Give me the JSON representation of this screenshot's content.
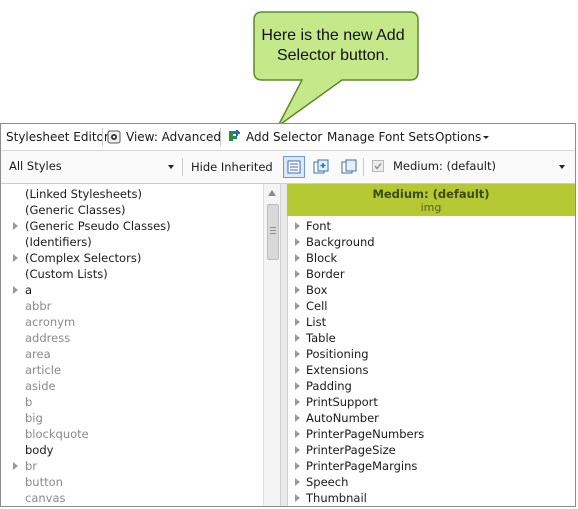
{
  "callout": {
    "text": "Here is the new Add Selector button."
  },
  "toolbar": {
    "stylesheet_editor": "Stylesheet Editor",
    "view": "View: Advanced",
    "add_selector": "Add Selector",
    "manage_font_sets": "Manage Font Sets",
    "options": "Options"
  },
  "filter": {
    "styles_selected": "All Styles",
    "hide_inherited": "Hide Inherited",
    "medium_selected": "Medium: (default)"
  },
  "left_tree": [
    {
      "label": "(Linked Stylesheets)",
      "expandable": false,
      "muted": false
    },
    {
      "label": "(Generic Classes)",
      "expandable": false,
      "muted": false
    },
    {
      "label": "(Generic Pseudo Classes)",
      "expandable": true,
      "muted": false
    },
    {
      "label": "(Identifiers)",
      "expandable": false,
      "muted": false
    },
    {
      "label": "(Complex Selectors)",
      "expandable": true,
      "muted": false
    },
    {
      "label": "(Custom Lists)",
      "expandable": false,
      "muted": false
    },
    {
      "label": "a",
      "expandable": true,
      "muted": false
    },
    {
      "label": "abbr",
      "expandable": false,
      "muted": true
    },
    {
      "label": "acronym",
      "expandable": false,
      "muted": true
    },
    {
      "label": "address",
      "expandable": false,
      "muted": true
    },
    {
      "label": "area",
      "expandable": false,
      "muted": true
    },
    {
      "label": "article",
      "expandable": false,
      "muted": true
    },
    {
      "label": "aside",
      "expandable": false,
      "muted": true
    },
    {
      "label": "b",
      "expandable": false,
      "muted": true
    },
    {
      "label": "big",
      "expandable": false,
      "muted": true
    },
    {
      "label": "blockquote",
      "expandable": false,
      "muted": true
    },
    {
      "label": "body",
      "expandable": false,
      "muted": false
    },
    {
      "label": "br",
      "expandable": true,
      "muted": true
    },
    {
      "label": "button",
      "expandable": false,
      "muted": true
    },
    {
      "label": "canvas",
      "expandable": false,
      "muted": true
    }
  ],
  "right_panel": {
    "medium_title": "Medium: (default)",
    "selector_tag": "img",
    "properties": [
      "Font",
      "Background",
      "Block",
      "Border",
      "Box",
      "Cell",
      "List",
      "Table",
      "Positioning",
      "Extensions",
      "Padding",
      "PrintSupport",
      "AutoNumber",
      "PrinterPageNumbers",
      "PrinterPageSize",
      "PrinterPageMargins",
      "Speech",
      "Thumbnail"
    ]
  },
  "colors": {
    "callout_fill": "#c5e88a",
    "callout_stroke": "#5f8a2b",
    "medium_header": "#b5c935"
  }
}
